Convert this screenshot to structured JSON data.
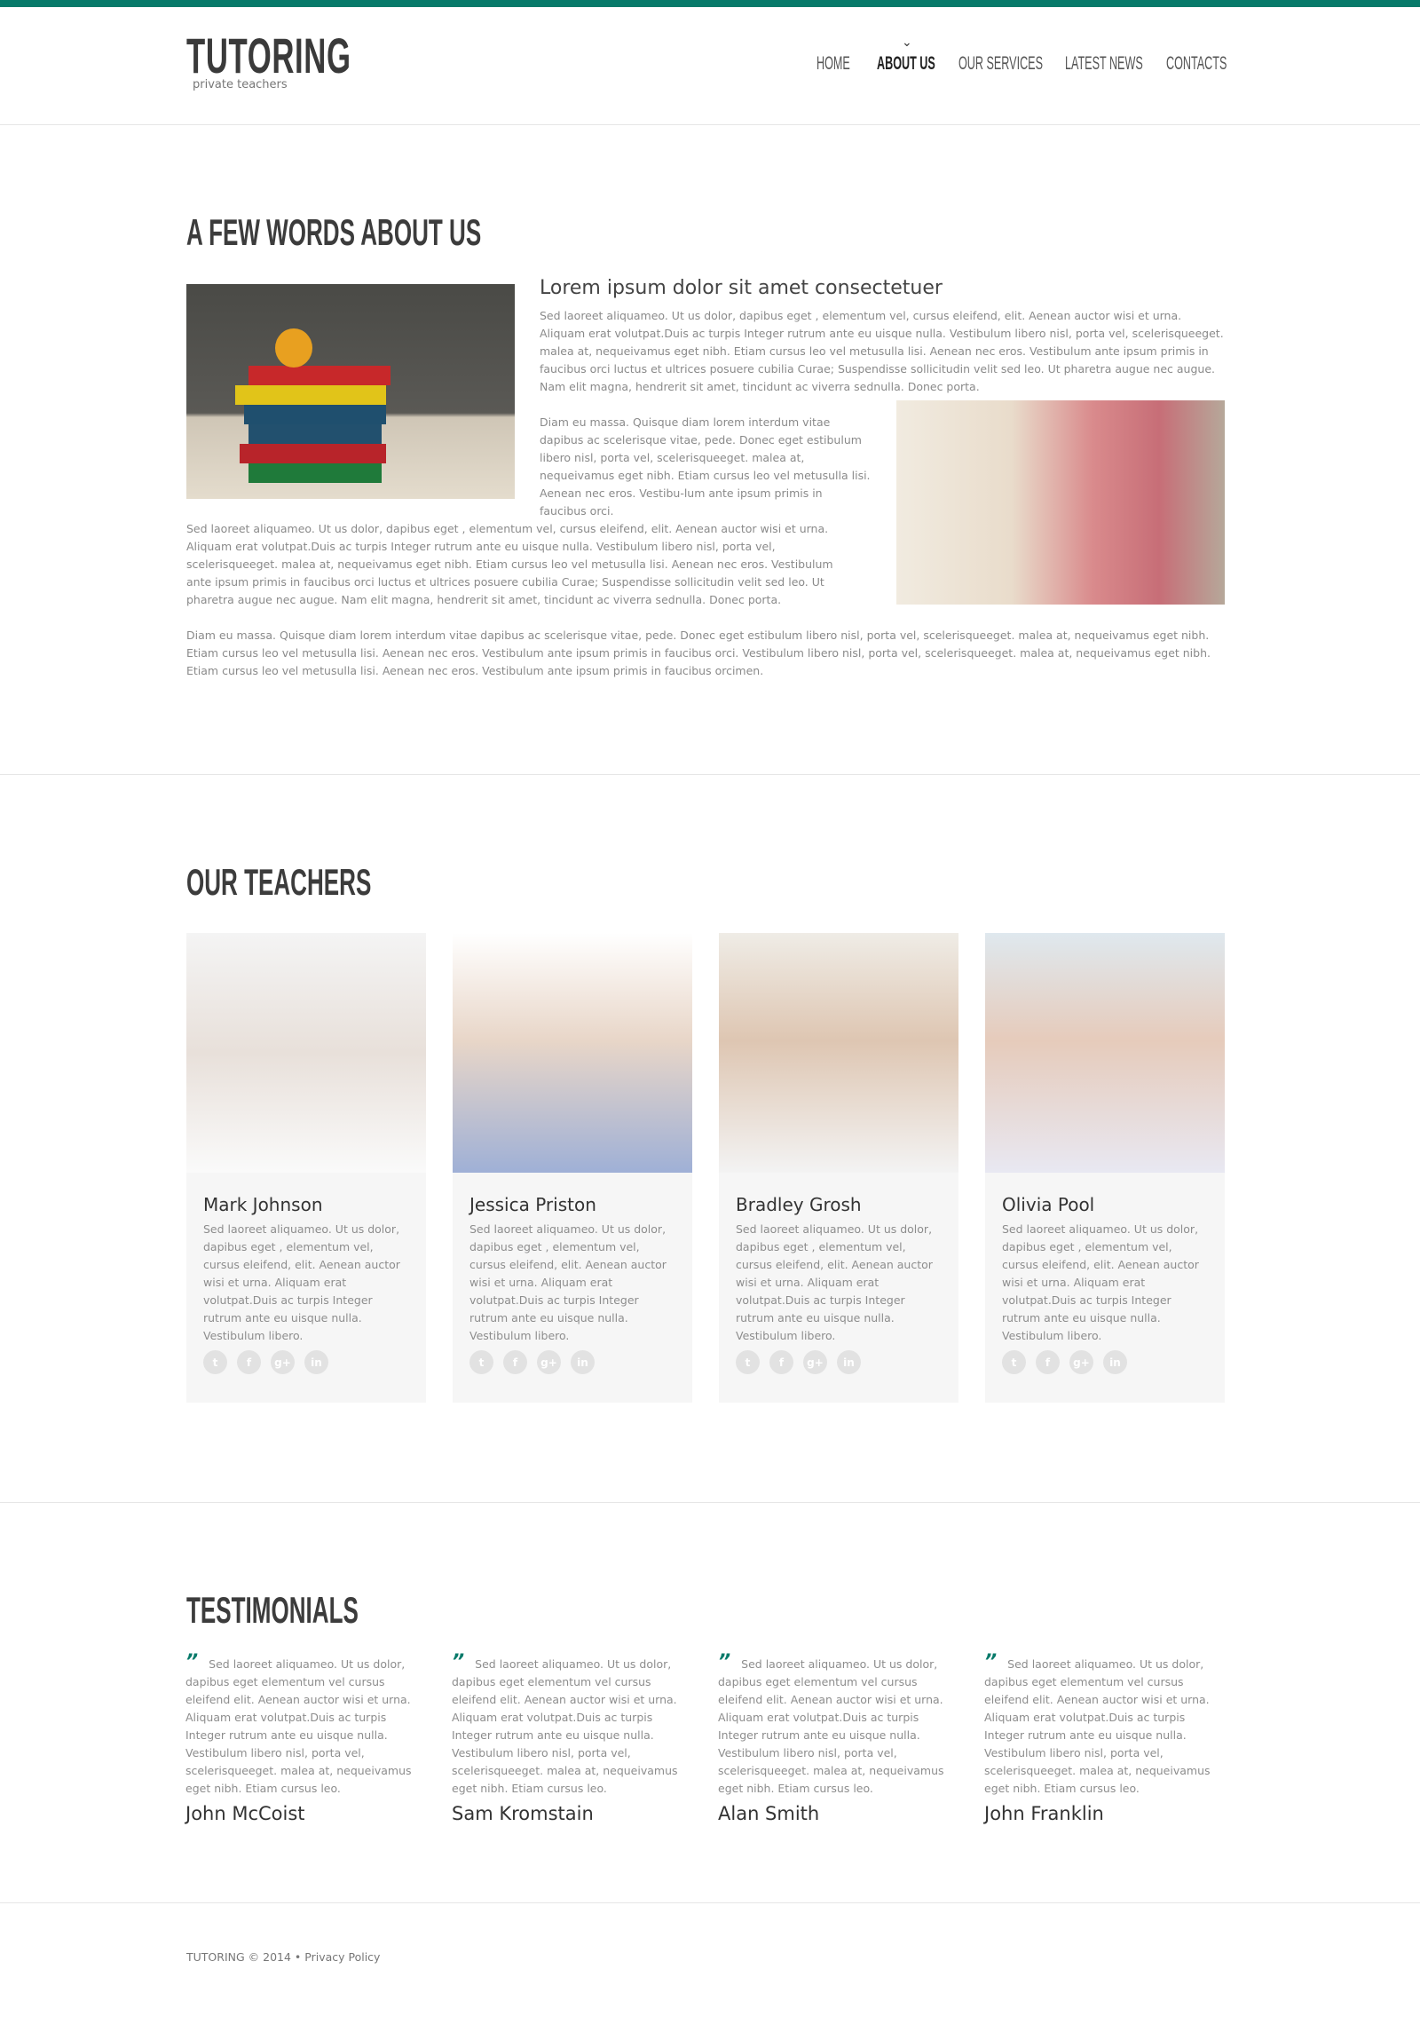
{
  "colors": {
    "accent": "#077a6a",
    "heading": "#3c3c3c",
    "text": "#8a8a8a",
    "card_bg": "#f6f6f6"
  },
  "header": {
    "logo": "TUTORING",
    "tagline": "private teachers",
    "nav": [
      {
        "label": "HOME"
      },
      {
        "label": "ABOUT US",
        "active": true
      },
      {
        "label": "OUR SERVICES"
      },
      {
        "label": "LATEST NEWS"
      },
      {
        "label": "CONTACTS"
      }
    ]
  },
  "about": {
    "title": "A FEW WORDS ABOUT US",
    "subtitle": "Lorem ipsum dolor sit amet consectetuer",
    "p1": "Sed laoreet aliquameo. Ut us dolor, dapibus eget , elementum vel, cursus eleifend, elit. Aenean auctor wisi et urna. Aliquam erat volutpat.Duis ac turpis Integer rutrum ante eu uisque nulla. Vestibulum libero nisl, porta vel, scelerisqueeget. malea at, nequeivamus eget nibh. Etiam cursus leo vel metusulla lisi.  Aenean nec eros. Vestibulum ante ipsum primis in faucibus orci luctus et ultrices posuere cubilia Curae; Suspendisse sollicitudin velit sed leo. Ut pharetra augue nec augue. Nam elit magna, hendrerit sit amet, tincidunt ac viverra sednulla. Donec porta.",
    "p2": "Diam eu massa. Quisque diam lorem interdum vitae dapibus ac  scelerisque vitae, pede. Donec eget estibulum libero nisl, porta vel, scelerisqueeget. malea at, nequeivamus eget nibh. Etiam cursus leo vel metusulla lisi.  Aenean nec eros. Vestibu-lum ante ipsum primis in faucibus orci.",
    "p3": "Sed laoreet aliquameo. Ut us dolor, dapibus eget , elementum vel, cursus eleifend, elit. Aenean auctor wisi et urna. Aliquam erat volutpat.Duis ac turpis Integer rutrum ante eu uisque nulla. Vestibulum libero nisl, porta vel, scelerisqueeget. malea at, nequeivamus eget nibh. Etiam cursus leo vel metusulla lisi.  Aenean nec eros. Vestibulum ante ipsum primis in faucibus orci luctus et ultrices posuere cubilia Curae; Suspendisse sollicitudin velit sed leo. Ut pharetra augue nec augue. Nam elit magna, hendrerit sit amet, tincidunt ac viverra sednulla. Donec porta.",
    "p4": "Diam eu massa. Quisque diam lorem interdum vitae dapibus ac  scelerisque vitae, pede. Donec eget estibulum libero nisl, porta vel, scelerisqueeget. malea at, nequeivamus eget nibh. Etiam cursus leo vel metusulla lisi.  Aenean nec eros. Vestibulum ante ipsum primis in faucibus orci. Vestibulum libero nisl, porta vel, scelerisqueeget. malea at, nequeivamus eget nibh. Etiam cursus leo vel metusulla lisi.  Aenean nec eros. Vestibulum ante ipsum primis in faucibus orcimen."
  },
  "teachers": {
    "title": "OUR TEACHERS",
    "bio": "Sed laoreet aliquameo. Ut us dolor, dapibus eget , elementum vel, cursus eleifend, elit. Aenean auctor wisi et urna. Aliquam erat volutpat.Duis ac turpis Integer rutrum ante eu uisque nulla. Vestibulum libero.",
    "items": [
      {
        "name": "Mark Johnson"
      },
      {
        "name": "Jessica Priston"
      },
      {
        "name": "Bradley Grosh"
      },
      {
        "name": "Olivia Pool"
      }
    ],
    "social_icons": [
      "twitter-icon",
      "facebook-icon",
      "google-plus-icon",
      "linkedin-icon"
    ],
    "social_glyphs": [
      "t",
      "f",
      "g+",
      "in"
    ]
  },
  "testimonials": {
    "title": "TESTIMONIALS",
    "quote_mark": "”",
    "body": "Sed laoreet aliquameo. Ut us dolor, dapibus eget elementum vel cursus eleifend elit. Aenean auctor wisi et urna. Aliquam erat volutpat.Duis ac turpis Integer rutrum ante eu uisque nulla. Vestibulum libero nisl, porta vel, scelerisqueeget. malea at, nequeivamus eget nibh. Etiam cursus leo.",
    "items": [
      {
        "author": "John McCoist"
      },
      {
        "author": "Sam Kromstain"
      },
      {
        "author": "Alan Smith"
      },
      {
        "author": "John Franklin"
      }
    ]
  },
  "footer": {
    "copyright": "TUTORING © 2014 •",
    "privacy": "Privacy Policy"
  }
}
